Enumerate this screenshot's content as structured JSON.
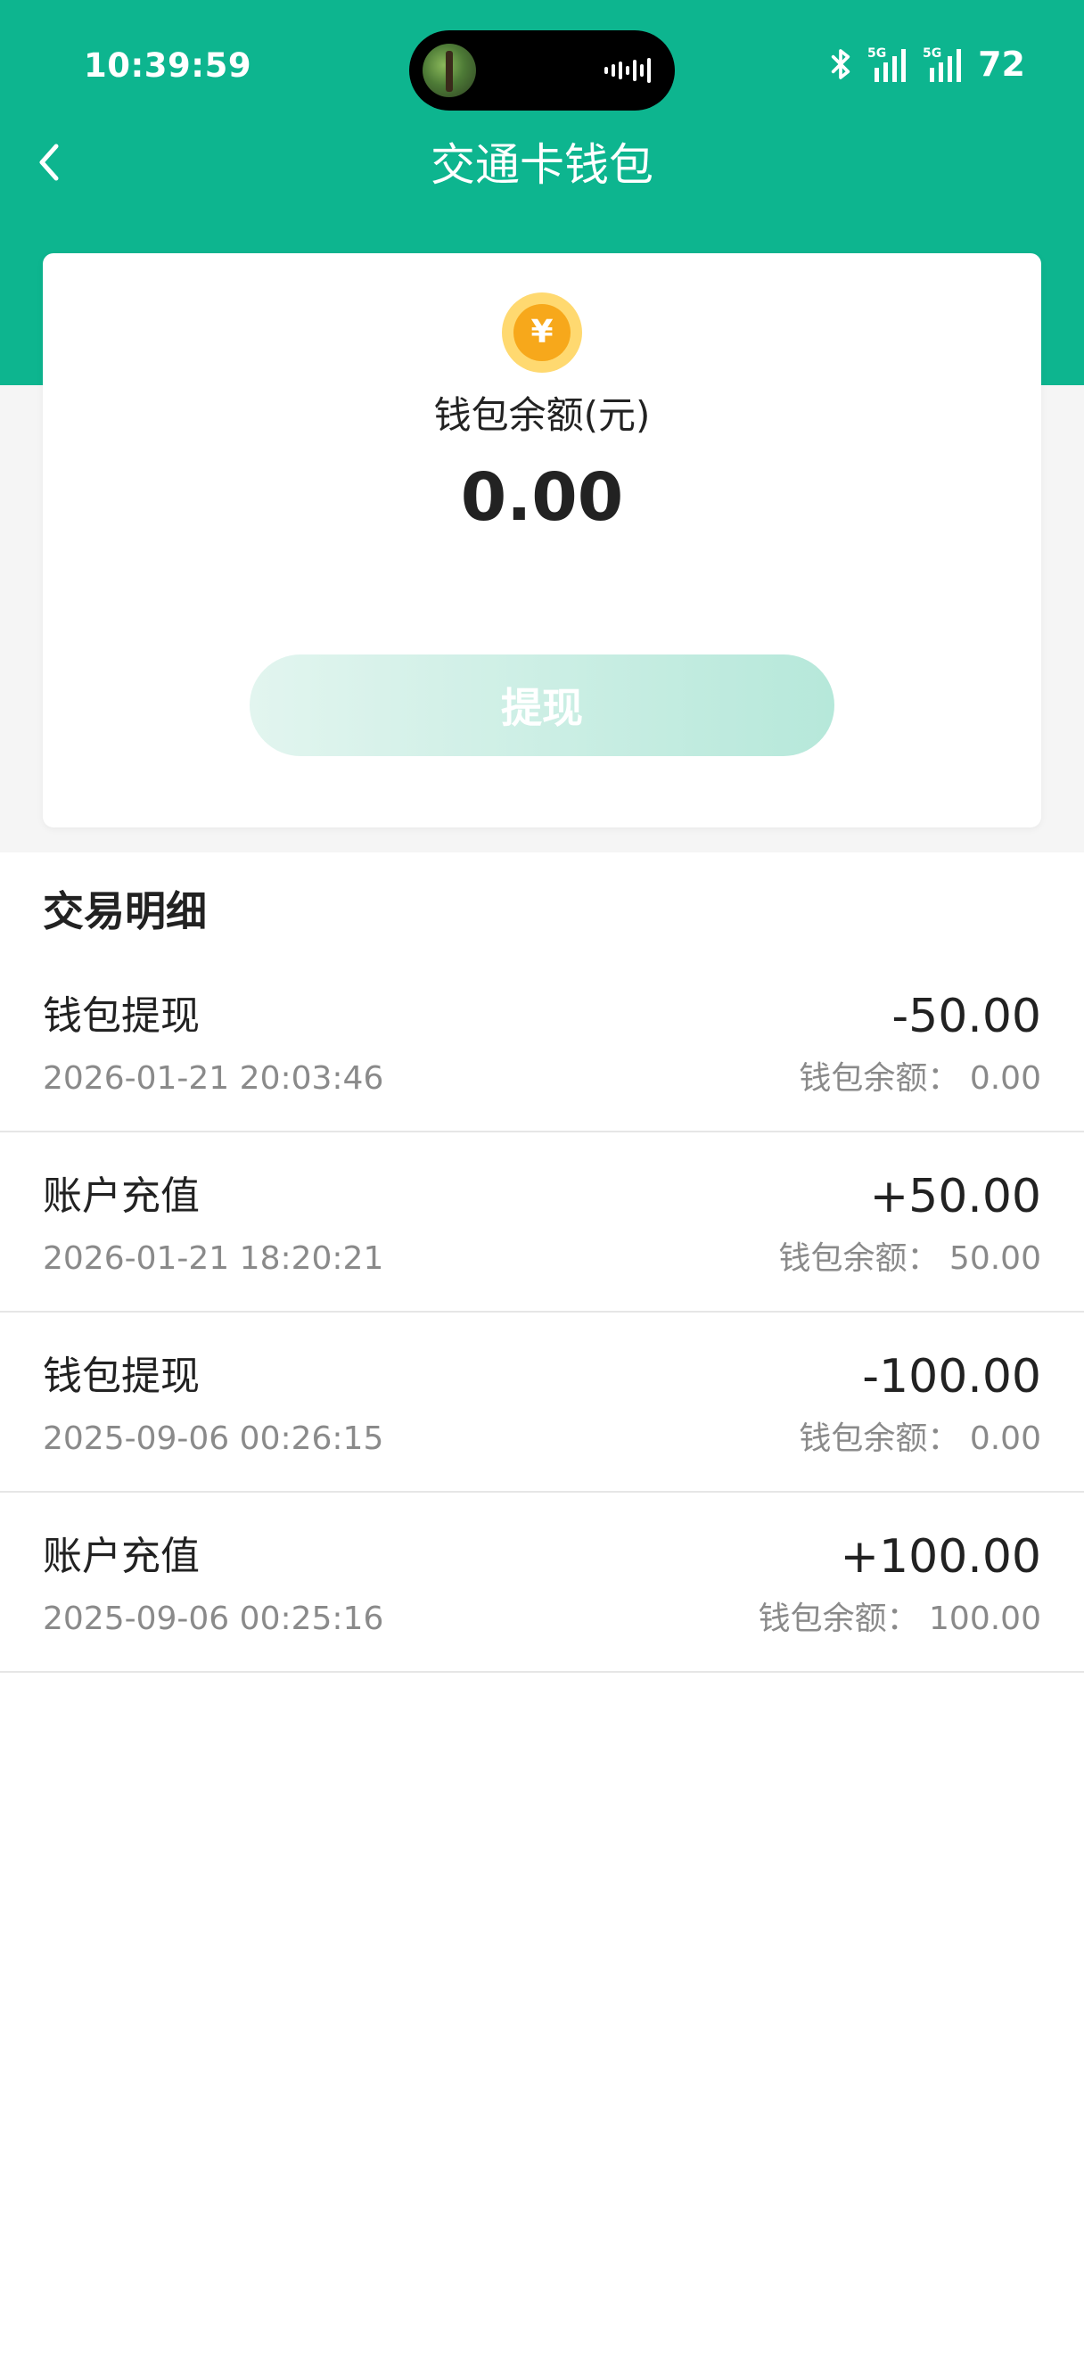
{
  "status_bar": {
    "time": "10:39:59",
    "network_1": "5G",
    "network_2": "5G",
    "battery": "72"
  },
  "header": {
    "title": "交通卡钱包",
    "back_icon": "chevron-left-icon",
    "background_color": "#0db58f"
  },
  "wallet": {
    "coin_icon": "yuan-coin-icon",
    "coin_symbol": "¥",
    "balance_label": "钱包余额(元)",
    "balance": "0.00",
    "withdraw_label": "提现"
  },
  "transactions": {
    "title": "交易明细",
    "items": [
      {
        "type": "钱包提现",
        "time": "2026-01-21 20:03:46",
        "amount": "-50.00",
        "balance": "钱包余额：  0.00"
      },
      {
        "type": "账户充值",
        "time": "2026-01-21 18:20:21",
        "amount": "+50.00",
        "balance": "钱包余额：  50.00"
      },
      {
        "type": "钱包提现",
        "time": "2025-09-06 00:26:15",
        "amount": "-100.00",
        "balance": "钱包余额：  0.00"
      },
      {
        "type": "账户充值",
        "time": "2025-09-06 00:25:16",
        "amount": "+100.00",
        "balance": "钱包余额：  100.00"
      }
    ]
  }
}
